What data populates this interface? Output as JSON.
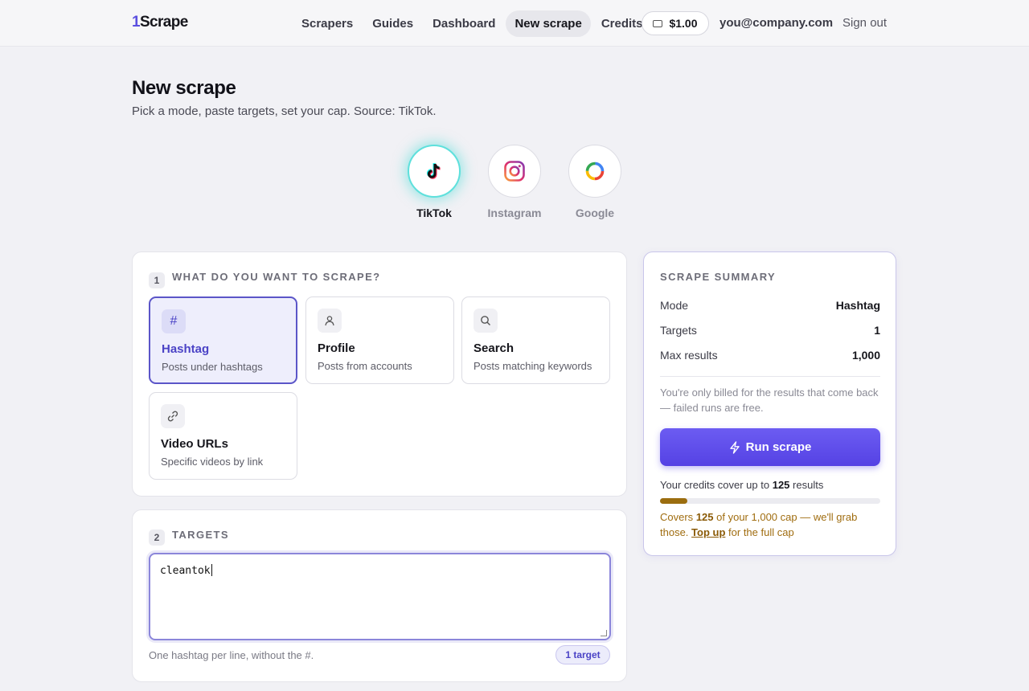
{
  "header": {
    "logo_one": "1",
    "logo_rest": "Scrape",
    "nav": [
      {
        "label": "Scrapers"
      },
      {
        "label": "Guides"
      },
      {
        "label": "Dashboard"
      },
      {
        "label": "New scrape",
        "active": true
      },
      {
        "label": "Credits"
      }
    ],
    "balance": "$1.00",
    "user_email": "you@company.com",
    "sign_out": "Sign out"
  },
  "page": {
    "title": "New scrape",
    "subtitle": "Pick a mode, paste targets, set your cap. Source: TikTok."
  },
  "sources": [
    {
      "label": "TikTok",
      "icon": "tiktok-icon",
      "selected": true
    },
    {
      "label": "Instagram",
      "icon": "instagram-icon",
      "selected": false
    },
    {
      "label": "Google",
      "icon": "google-icon",
      "selected": false
    }
  ],
  "step1": {
    "number": "1",
    "title": "WHAT DO YOU WANT TO SCRAPE?",
    "modes": [
      {
        "name": "Hashtag",
        "desc": "Posts under hashtags",
        "icon": "hash-icon",
        "selected": true
      },
      {
        "name": "Profile",
        "desc": "Posts from accounts",
        "icon": "user-icon",
        "selected": false
      },
      {
        "name": "Search",
        "desc": "Posts matching keywords",
        "icon": "search-icon",
        "selected": false
      },
      {
        "name": "Video URLs",
        "desc": "Specific videos by link",
        "icon": "link-icon",
        "selected": false
      }
    ]
  },
  "step2": {
    "number": "2",
    "title": "TARGETS",
    "value": "cleantok",
    "hint": "One hashtag per line, without the #.",
    "count_badge": "1 target"
  },
  "summary": {
    "title": "SCRAPE SUMMARY",
    "rows": [
      {
        "key": "Mode",
        "value": "Hashtag"
      },
      {
        "key": "Targets",
        "value": "1"
      },
      {
        "key": "Max results",
        "value": "1,000"
      }
    ],
    "billing_note": "You're only billed for the results that come back — failed runs are free.",
    "run_label": "Run scrape",
    "cover_prefix": "Your credits cover up to",
    "cover_count": "125",
    "cover_suffix": "results",
    "cover_fraction": 0.125,
    "warn_prefix": "Covers",
    "warn_count": "125",
    "warn_mid": "of your 1,000 cap — we'll grab those.",
    "warn_link": "Top up",
    "warn_suffix": "for the full cap"
  },
  "colors": {
    "accent": "#5b4fe0",
    "selected_border": "#5b55c8",
    "warning": "#a06d10",
    "tiktok_glow": "#5ee0dc"
  }
}
